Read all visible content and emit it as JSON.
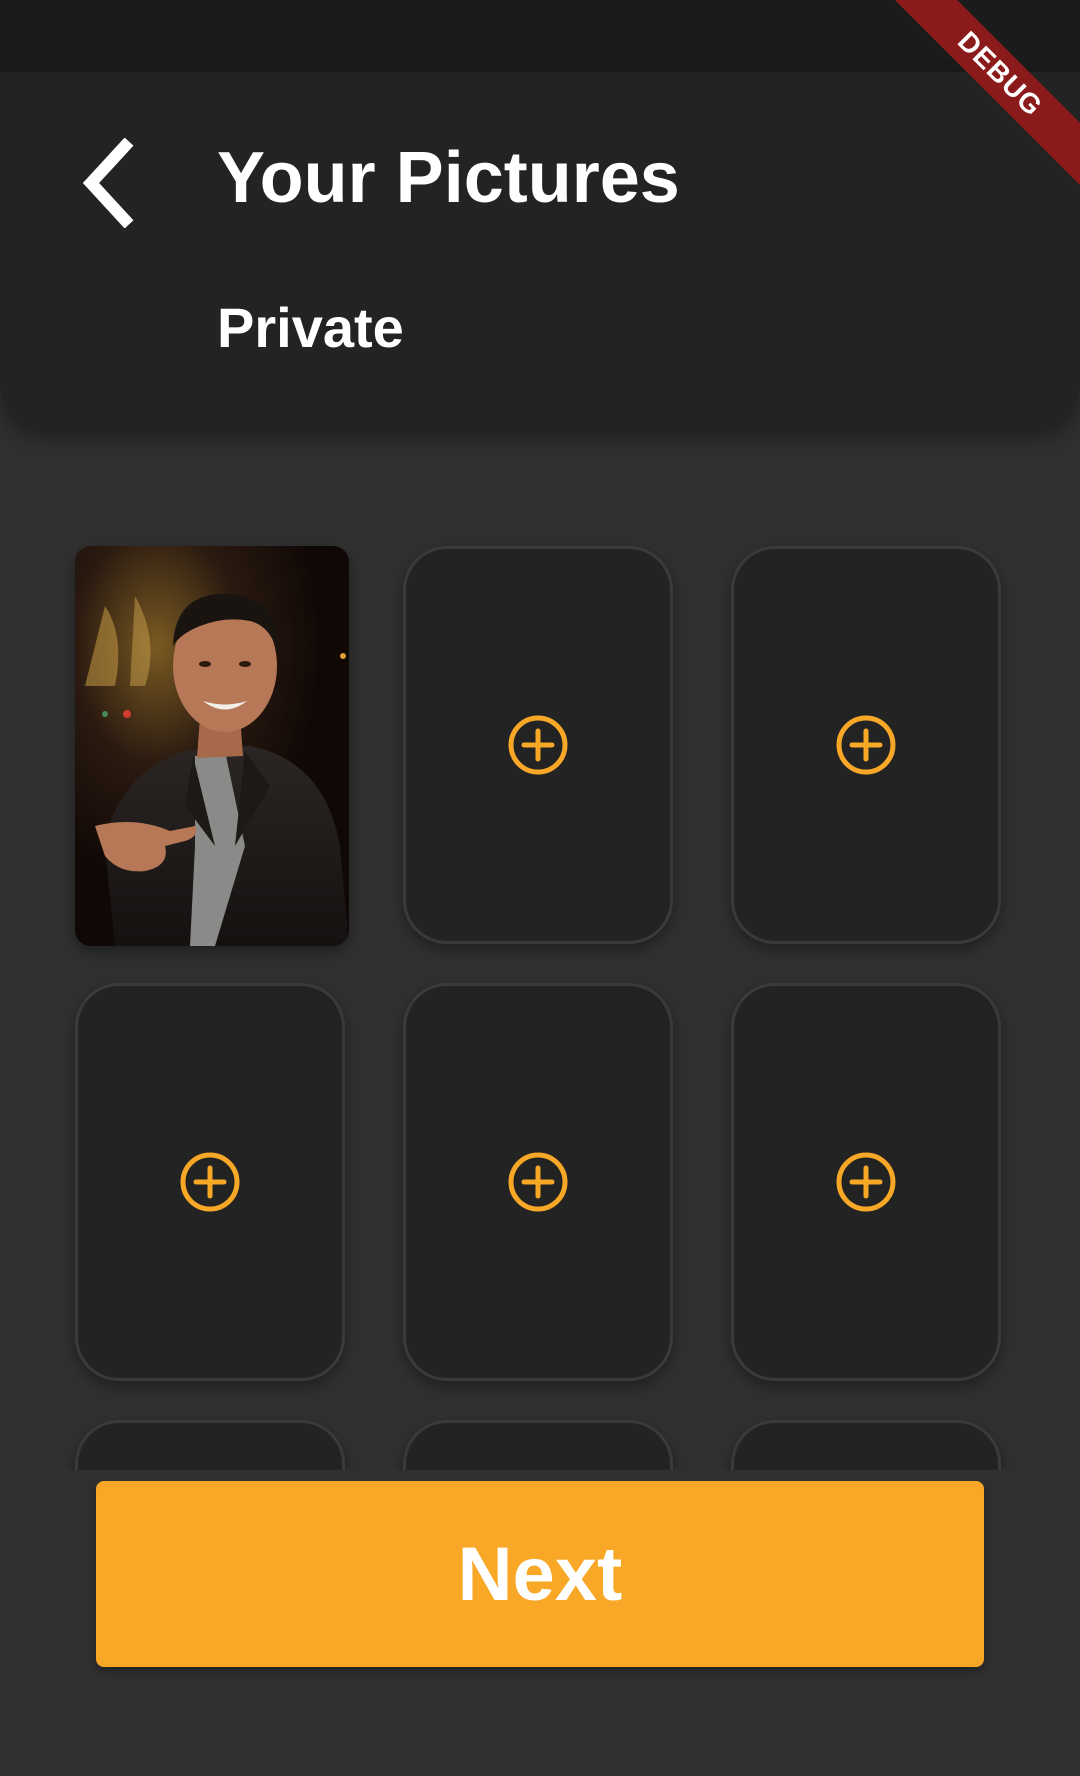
{
  "header": {
    "title": "Your Pictures",
    "subtitle": "Private",
    "back_icon": "chevron-left-icon"
  },
  "debug_banner": {
    "label": "DEBUG",
    "color": "#8b1a1a"
  },
  "colors": {
    "accent": "#f8a826",
    "background": "#303030",
    "card": "#232323"
  },
  "pictures": {
    "slots": [
      {
        "state": "filled",
        "content": "photo of smiling man in dark suit"
      },
      {
        "state": "empty",
        "icon": "add-circle-icon"
      },
      {
        "state": "empty",
        "icon": "add-circle-icon"
      },
      {
        "state": "empty",
        "icon": "add-circle-icon"
      },
      {
        "state": "empty",
        "icon": "add-circle-icon"
      },
      {
        "state": "empty",
        "icon": "add-circle-icon"
      },
      {
        "state": "empty",
        "icon": "add-circle-icon"
      },
      {
        "state": "empty",
        "icon": "add-circle-icon"
      },
      {
        "state": "empty",
        "icon": "add-circle-icon"
      }
    ]
  },
  "actions": {
    "next_label": "Next"
  }
}
